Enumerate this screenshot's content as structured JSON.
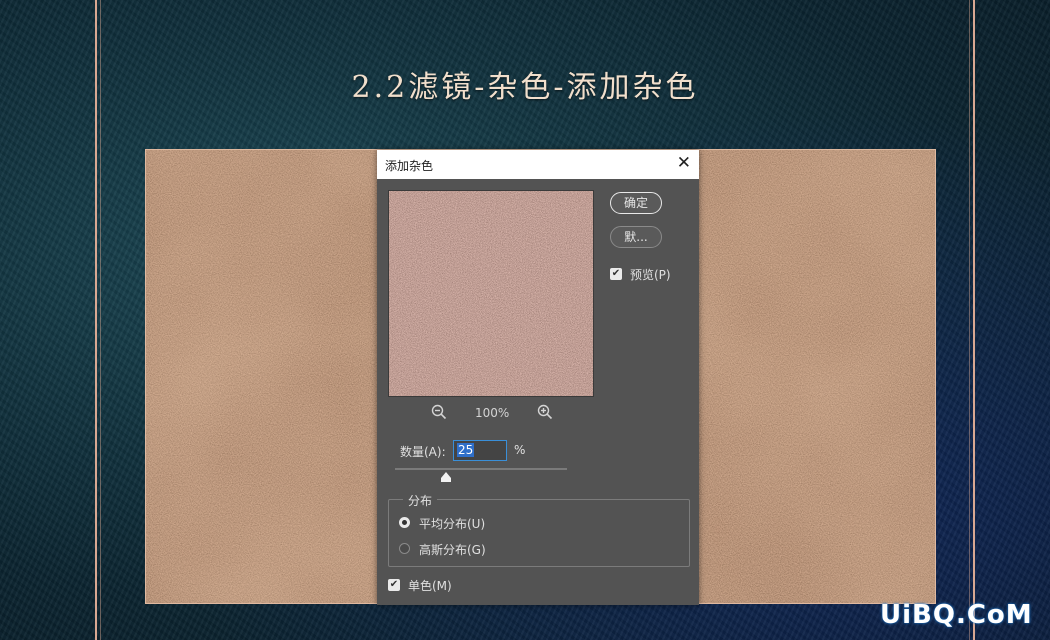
{
  "title": "2.2滤镜-杂色-添加杂色",
  "dialog": {
    "title": "添加杂色",
    "close_symbol": "✕",
    "ok_label": "确定",
    "default_label": "默...",
    "preview_label": "预览(P)",
    "preview_checked": true,
    "zoom": "100%",
    "amount_label": "数量(A):",
    "amount_value": "25",
    "amount_unit": "%",
    "distribution_label": "分布",
    "uniform_label": "平均分布(U)",
    "gaussian_label": "高斯分布(G)",
    "selected_distribution": "uniform",
    "monochrome_label": "单色(M)",
    "monochrome_checked": true
  },
  "watermark": "UiBQ.CoM",
  "colors": {
    "frame": "#d9a892",
    "dialog_bg": "#535353",
    "texture_brown": "#7a4e35",
    "accent_blue": "#3a8fd8"
  },
  "icons": {
    "zoom_out": "zoom-out-icon",
    "zoom_in": "zoom-in-icon",
    "close": "close-icon"
  }
}
